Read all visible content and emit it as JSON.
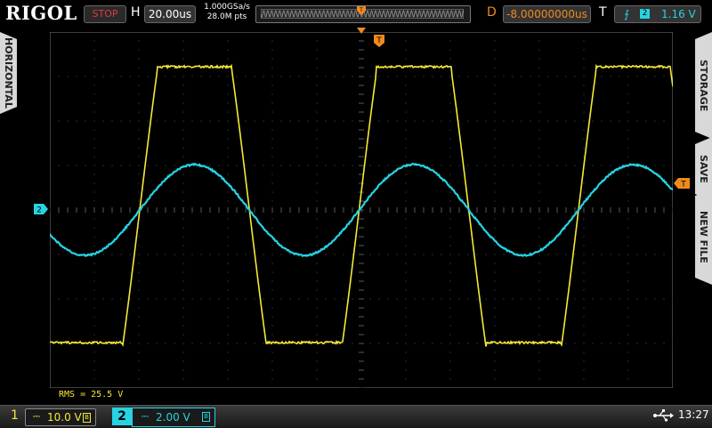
{
  "brand": "RIGOL",
  "run_state": "STOP",
  "horizontal": {
    "label": "H",
    "timebase": "20.00us"
  },
  "acquisition": {
    "sample_rate": "1.000GSa/s",
    "memory_depth": "28.0M pts"
  },
  "delay": {
    "label": "D",
    "value": "-8.00000000us"
  },
  "trigger": {
    "label": "T",
    "edge_symbol": "⨍",
    "source": "2",
    "level": "1.16 V"
  },
  "side_tabs": {
    "left": "HORIZONTAL",
    "right": [
      "STORAGE",
      "SAVE",
      "NEW FILE"
    ]
  },
  "measurement": "RMS = 25.5 V",
  "channels": [
    {
      "number": "1",
      "coupling": "⎓",
      "scale": "10.0 V",
      "bw": "B",
      "color": "#f4e93a"
    },
    {
      "number": "2",
      "coupling": "⎓",
      "scale": "2.00 V",
      "bw": "B",
      "color": "#27d3e3"
    }
  ],
  "markers": {
    "trigger_pos": "T",
    "ch2_ground": "2",
    "trig_level": "T"
  },
  "clock": "13:27",
  "colors": {
    "ch1": "#f4e93a",
    "ch2": "#27d3e3",
    "trigger": "#f08a1c",
    "grid": "#5a5a5a"
  }
}
